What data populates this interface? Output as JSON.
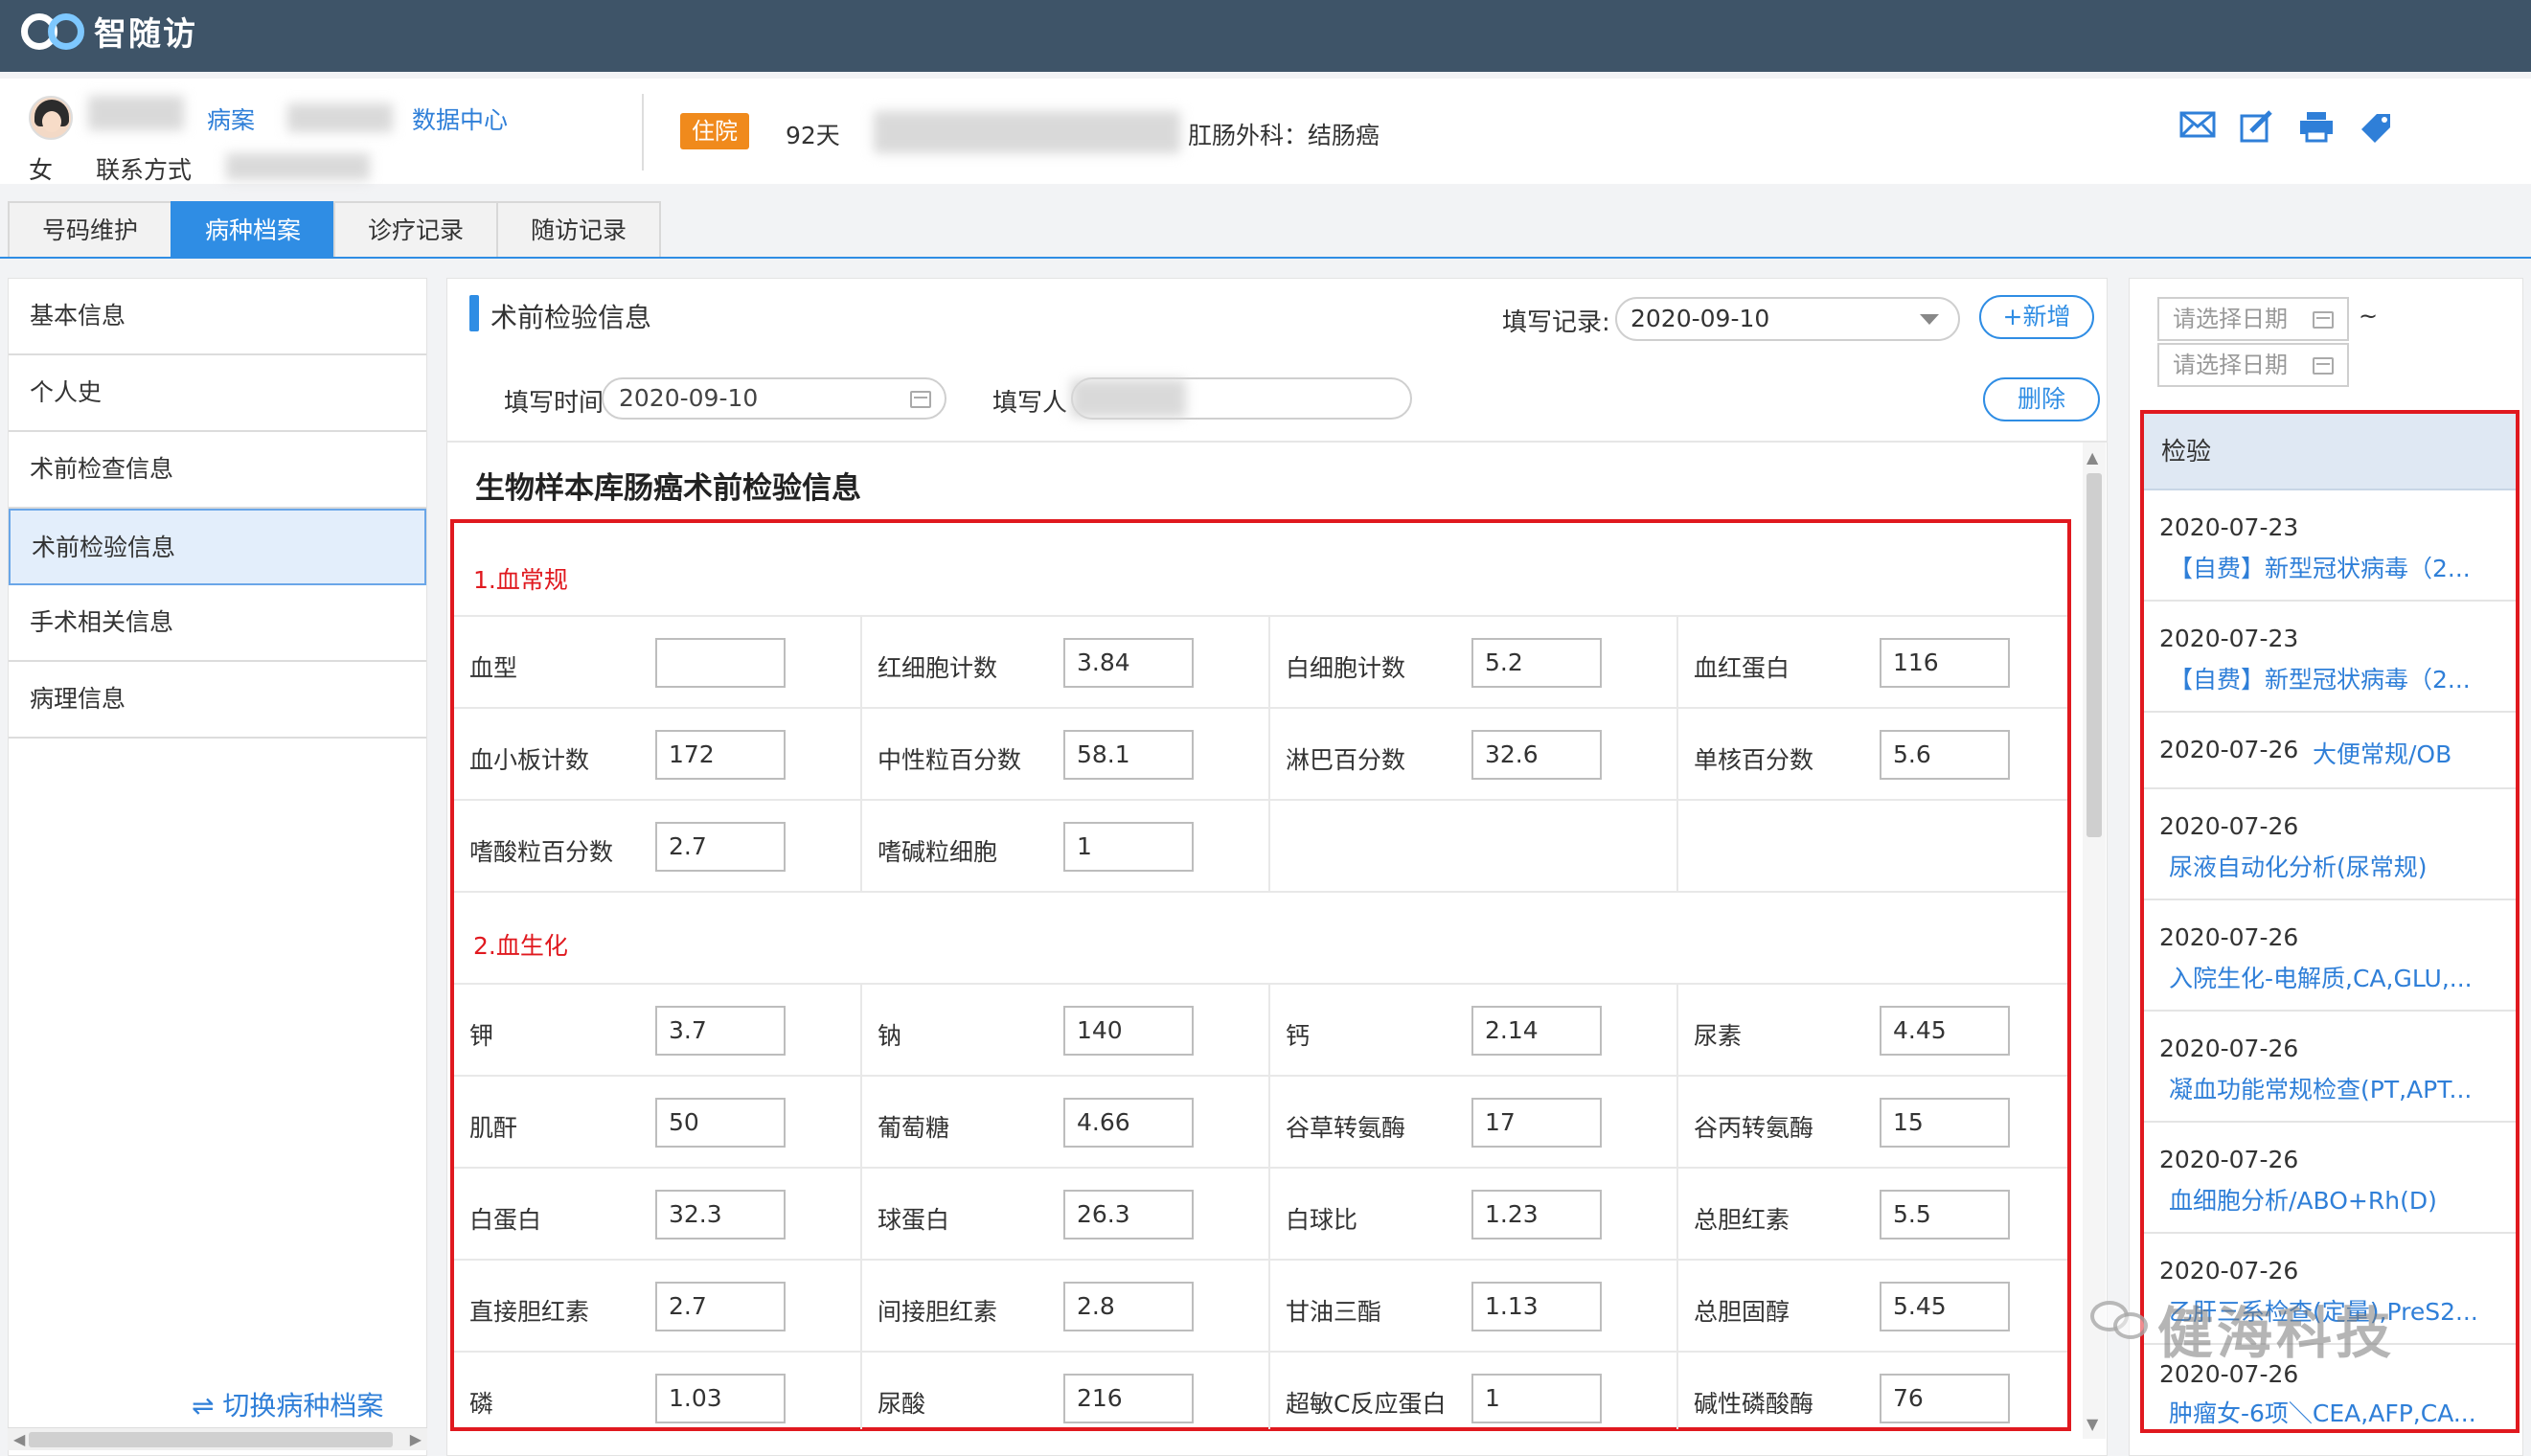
{
  "app": {
    "name": "智随访"
  },
  "patient": {
    "gender": "女",
    "contact_label": "联系方式",
    "link_partial": "病案",
    "data_center": "数据中心",
    "status_badge": "住院",
    "days": "92天",
    "department": "肛肠外科：结肠癌"
  },
  "header_icons": [
    "mail-icon",
    "edit-icon",
    "print-icon",
    "tag-icon"
  ],
  "tabs": [
    {
      "label": "号码维护",
      "active": false
    },
    {
      "label": "病种档案",
      "active": true
    },
    {
      "label": "诊疗记录",
      "active": false
    },
    {
      "label": "随访记录",
      "active": false
    }
  ],
  "sidebar": {
    "items": [
      {
        "label": "基本信息"
      },
      {
        "label": "个人史"
      },
      {
        "label": "术前检查信息"
      },
      {
        "label": "术前检验信息"
      },
      {
        "label": "手术相关信息"
      },
      {
        "label": "病理信息"
      }
    ],
    "active_index": 3,
    "switch_label": "⇌ 切换病种档案"
  },
  "main": {
    "section_title": "术前检验信息",
    "record_label": "填写记录:",
    "record_value": "2020-09-10",
    "add_button": "+新增",
    "fill_time_label": "填写时间",
    "fill_time_value": "2020-09-10",
    "filler_label": "填写人",
    "delete_button": "删除",
    "form_title": "生物样本库肠癌术前检验信息",
    "groups": [
      {
        "title": "1.血常规",
        "rows": [
          [
            {
              "label": "血型",
              "value": ""
            },
            {
              "label": "红细胞计数",
              "value": "3.84"
            },
            {
              "label": "白细胞计数",
              "value": "5.2"
            },
            {
              "label": "血红蛋白",
              "value": "116"
            }
          ],
          [
            {
              "label": "血小板计数",
              "value": "172"
            },
            {
              "label": "中性粒百分数",
              "value": "58.1"
            },
            {
              "label": "淋巴百分数",
              "value": "32.6"
            },
            {
              "label": "单核百分数",
              "value": "5.6"
            }
          ],
          [
            {
              "label": "嗜酸粒百分数",
              "value": "2.7"
            },
            {
              "label": "嗜碱粒细胞",
              "value": "1"
            }
          ]
        ]
      },
      {
        "title": "2.血生化",
        "rows": [
          [
            {
              "label": "钾",
              "value": "3.7"
            },
            {
              "label": "钠",
              "value": "140"
            },
            {
              "label": "钙",
              "value": "2.14"
            },
            {
              "label": "尿素",
              "value": "4.45"
            }
          ],
          [
            {
              "label": "肌酐",
              "value": "50"
            },
            {
              "label": "葡萄糖",
              "value": "4.66"
            },
            {
              "label": "谷草转氨酶",
              "value": "17"
            },
            {
              "label": "谷丙转氨酶",
              "value": "15"
            }
          ],
          [
            {
              "label": "白蛋白",
              "value": "32.3"
            },
            {
              "label": "球蛋白",
              "value": "26.3"
            },
            {
              "label": "白球比",
              "value": "1.23"
            },
            {
              "label": "总胆红素",
              "value": "5.5"
            }
          ],
          [
            {
              "label": "直接胆红素",
              "value": "2.7"
            },
            {
              "label": "间接胆红素",
              "value": "2.8"
            },
            {
              "label": "甘油三酯",
              "value": "1.13"
            },
            {
              "label": "总胆固醇",
              "value": "5.45"
            }
          ],
          [
            {
              "label": "磷",
              "value": "1.03"
            },
            {
              "label": "尿酸",
              "value": "216"
            },
            {
              "label": "超敏C反应蛋白",
              "value": "1"
            },
            {
              "label": "碱性磷酸酶",
              "value": "76"
            }
          ]
        ]
      }
    ]
  },
  "right": {
    "date_placeholder_1": "请选择日期",
    "date_placeholder_2": "请选择日期",
    "tilde": "~",
    "header": "检验",
    "items": [
      {
        "date": "2020-07-23",
        "title": "【自费】新型冠状病毒（2...",
        "inline": false
      },
      {
        "date": "2020-07-23",
        "title": "【自费】新型冠状病毒（2...",
        "inline": false
      },
      {
        "date": "2020-07-26",
        "title": "大便常规/OB",
        "inline": true
      },
      {
        "date": "2020-07-26",
        "title": "尿液自动化分析(尿常规)",
        "inline": false
      },
      {
        "date": "2020-07-26",
        "title": "入院生化-电解质,CA,GLU,...",
        "inline": false
      },
      {
        "date": "2020-07-26",
        "title": "凝血功能常规检查(PT,APT...",
        "inline": false
      },
      {
        "date": "2020-07-26",
        "title": "血细胞分析/ABO+Rh(D)",
        "inline": false
      },
      {
        "date": "2020-07-26",
        "title": "乙肝三系检查(定量),PreS2...",
        "inline": false
      },
      {
        "date": "2020-07-26",
        "title": "肿瘤女-6项＼CEA,AFP,CA...",
        "inline": false
      }
    ]
  },
  "watermark": "健海科技"
}
